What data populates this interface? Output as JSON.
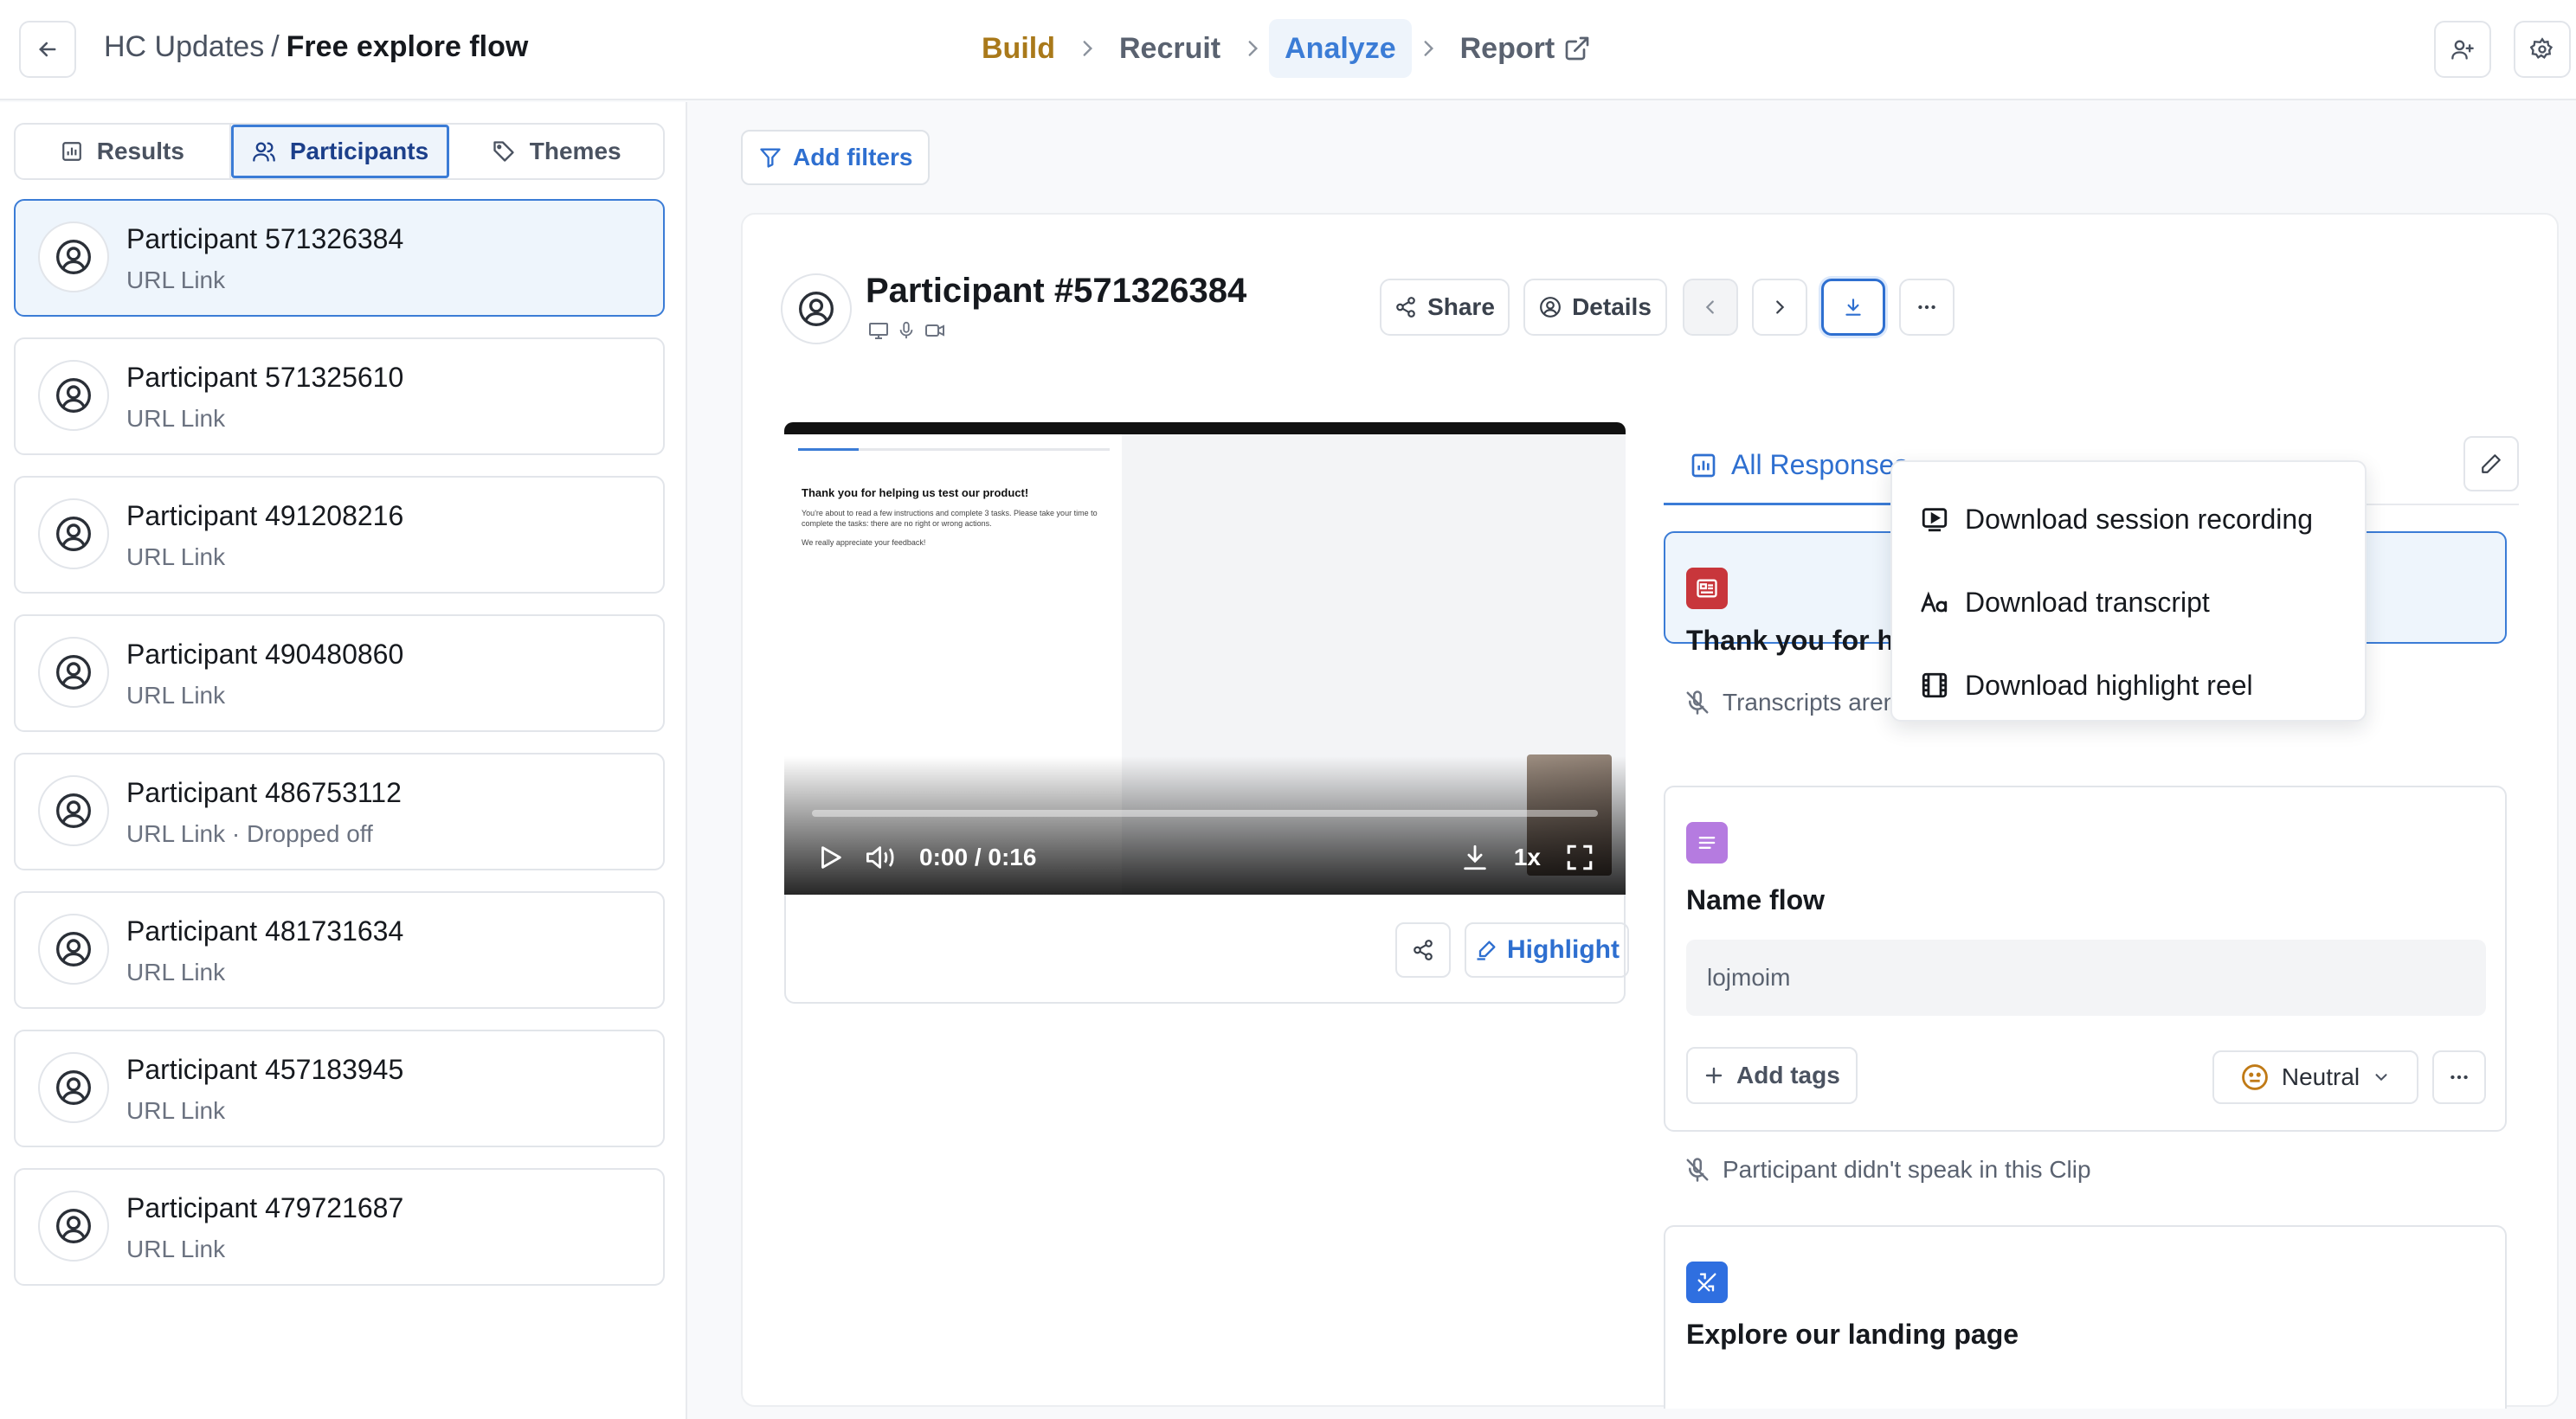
{
  "header": {
    "project": "HC Updates",
    "separator": "/",
    "study": "Free explore flow",
    "steps": [
      {
        "label": "Build"
      },
      {
        "label": "Recruit"
      },
      {
        "label": "Analyze"
      },
      {
        "label": "Report"
      }
    ],
    "active_step": "Analyze"
  },
  "sidebar": {
    "tabs": [
      {
        "label": "Results",
        "icon": "bar-chart-icon"
      },
      {
        "label": "Participants",
        "icon": "users-icon"
      },
      {
        "label": "Themes",
        "icon": "tag-icon"
      }
    ],
    "active_tab": "Participants",
    "participants": [
      {
        "name": "Participant 571326384",
        "sub": "URL Link",
        "selected": true
      },
      {
        "name": "Participant 571325610",
        "sub": "URL Link"
      },
      {
        "name": "Participant 491208216",
        "sub": "URL Link"
      },
      {
        "name": "Participant 490480860",
        "sub": "URL Link"
      },
      {
        "name": "Participant 486753112",
        "sub": "URL Link · Dropped off"
      },
      {
        "name": "Participant 481731634",
        "sub": "URL Link"
      },
      {
        "name": "Participant 457183945",
        "sub": "URL Link"
      },
      {
        "name": "Participant 479721687",
        "sub": "URL Link"
      }
    ]
  },
  "main": {
    "filter_label": "Add filters",
    "participant_title": "Participant #571326384",
    "share_label": "Share",
    "details_label": "Details",
    "video": {
      "doc_heading": "Thank you for helping us test our product!",
      "doc_text1": "You're about to read a few instructions and complete 3 tasks. Please take your time to complete the tasks: there are no right or wrong actions.",
      "doc_text2": "We really appreciate your feedback!",
      "time": "0:00 / 0:16",
      "speed": "1x",
      "progress": 0
    },
    "highlight_label": "Highlight",
    "responses_tab": "All Responses",
    "block1": {
      "title": "Thank you for helping us test our product!",
      "note": "Transcripts aren’t created for clips shorter than 2 seconds"
    },
    "block2": {
      "title": "Name flow",
      "answer": "lojmoim",
      "add_tags": "Add tags",
      "sentiment": "Neutral",
      "note": "Participant didn't speak in this Clip"
    },
    "block3": {
      "title": "Explore our landing page"
    }
  },
  "download_menu": {
    "items": [
      {
        "label": "Download session recording",
        "icon": "video-play-icon"
      },
      {
        "label": "Download transcript",
        "icon": "text-aa-icon"
      },
      {
        "label": "Download highlight reel",
        "icon": "film-icon"
      }
    ]
  },
  "colors": {
    "accent": "#3b7cd6",
    "build": "#a9791a",
    "red_badge": "#c8363b",
    "purple_badge": "#b57be0",
    "blue_badge": "#2f6fe0"
  }
}
